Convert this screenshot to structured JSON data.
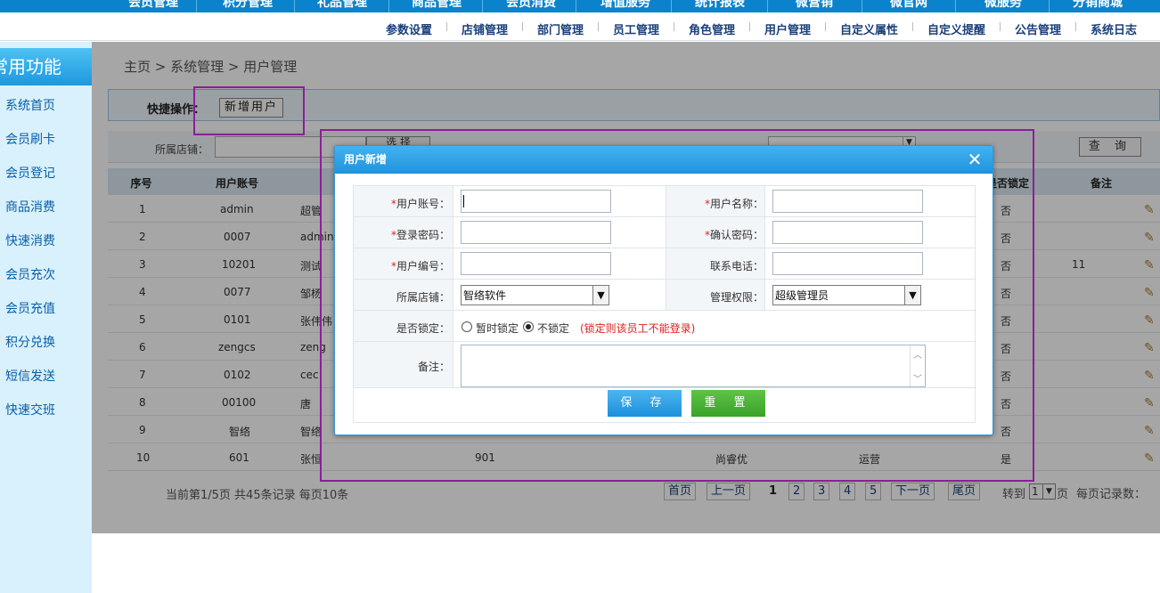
{
  "top_nav": [
    "会员管理",
    "积分管理",
    "礼品管理",
    "商品管理",
    "会员消费",
    "增值服务",
    "统计报表",
    "微营销",
    "微官网",
    "微服务",
    "分销商城"
  ],
  "sub_nav": [
    "参数设置",
    "店铺管理",
    "部门管理",
    "员工管理",
    "角色管理",
    "用户管理",
    "自定义属性",
    "自定义提醒",
    "公告管理",
    "系统日志"
  ],
  "sidebar": {
    "title": "常用功能",
    "items": [
      "系统首页",
      "会员刷卡",
      "会员登记",
      "商品消费",
      "快速消费",
      "会员充次",
      "会员充值",
      "积分兑换",
      "短信发送",
      "快速交班"
    ]
  },
  "breadcrumb": "主页 > 系统管理 > 用户管理",
  "quick_ops": {
    "label": "快捷操作：",
    "add_user": "新增用户"
  },
  "filter": {
    "store_label": "所属店铺：",
    "select_btn": "选 择",
    "query_btn": "查 询"
  },
  "table": {
    "headers": {
      "seq": "序号",
      "account": "用户账号",
      "locked": "是否锁定",
      "note": "备注"
    },
    "rows": [
      {
        "seq": "1",
        "account": "admin",
        "name": "超管",
        "locked": "否",
        "note": ""
      },
      {
        "seq": "2",
        "account": "0007",
        "name": "admin",
        "locked": "否",
        "note": ""
      },
      {
        "seq": "3",
        "account": "10201",
        "name": "测试",
        "locked": "否",
        "note": "11"
      },
      {
        "seq": "4",
        "account": "0077",
        "name": "邹杨",
        "locked": "否",
        "note": ""
      },
      {
        "seq": "5",
        "account": "0101",
        "name": "张伟伟",
        "locked": "否",
        "note": ""
      },
      {
        "seq": "6",
        "account": "zengcs",
        "name": "zeng",
        "locked": "否",
        "note": ""
      },
      {
        "seq": "7",
        "account": "0102",
        "name": "cec",
        "locked": "否",
        "note": ""
      },
      {
        "seq": "8",
        "account": "00100",
        "name": "唐",
        "locked": "否",
        "note": ""
      },
      {
        "seq": "9",
        "account": "智络",
        "name": "智络",
        "locked": "否",
        "note": ""
      },
      {
        "seq": "10",
        "account": "601",
        "name": "张恒",
        "code": "901",
        "store": "尚睿优",
        "role": "运营",
        "locked": "是",
        "note": ""
      }
    ]
  },
  "pager": {
    "summary": "当前第1/5页 共45条记录 每页10条",
    "first": "首页",
    "prev": "上一页",
    "pages": [
      "1",
      "2",
      "3",
      "4",
      "5"
    ],
    "next": "下一页",
    "last": "尾页",
    "goto_label": "转到",
    "goto_value": "1",
    "goto_suffix": "页",
    "per_page_label": "每页记录数："
  },
  "dialog": {
    "title": "用户新增",
    "close": "✕",
    "fields": {
      "account_label": "用户账号：",
      "name_label": "用户名称：",
      "password_label": "登录密码：",
      "confirm_label": "确认密码：",
      "code_label": "用户编号：",
      "phone_label": "联系电话：",
      "store_label": "所属店铺：",
      "store_value": "智络软件",
      "role_label": "管理权限：",
      "role_value": "超级管理员",
      "lock_label": "是否锁定：",
      "lock_opt1": "暂时锁定",
      "lock_opt2": "不锁定",
      "lock_selected": "不锁定",
      "lock_hint": "(锁定则该员工不能登录)",
      "note_label": "备注："
    },
    "save": "保 存",
    "reset": "重 置"
  },
  "colors": {
    "accent": "#1e98de",
    "highlight": "#8a1f99",
    "save": "#1d90db",
    "reset": "#3aa12a",
    "required": "#e02020"
  }
}
